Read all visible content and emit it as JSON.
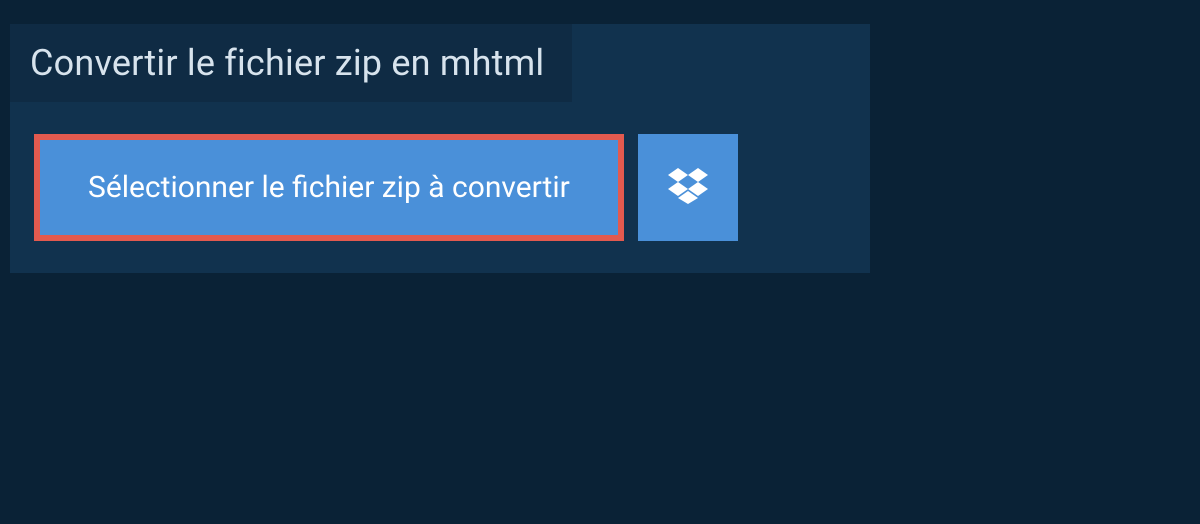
{
  "heading": "Convertir le fichier zip en mhtml",
  "buttons": {
    "select_file_label": "Sélectionner le fichier zip à convertir"
  },
  "colors": {
    "page_bg": "#0a2236",
    "panel_bg": "#11324e",
    "heading_bg": "#0f2b44",
    "button_bg": "#4a90d9",
    "button_border_highlight": "#e35a4f",
    "text_light": "#d7e3ed",
    "text_on_button": "#ffffff"
  }
}
